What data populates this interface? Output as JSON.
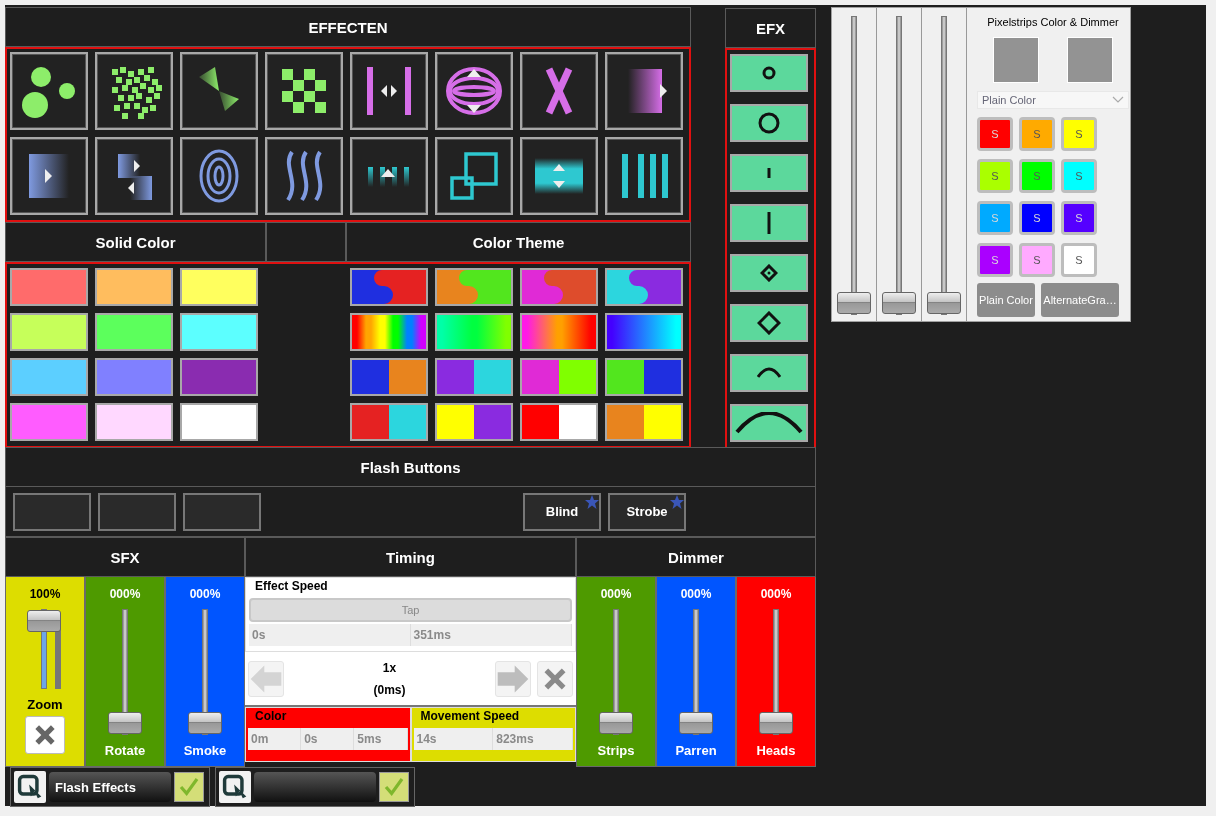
{
  "effecten": {
    "title": "EFFECTEN",
    "effects": [
      {
        "kind": "circles"
      },
      {
        "kind": "scatter"
      },
      {
        "kind": "wedge"
      },
      {
        "kind": "checker"
      },
      {
        "kind": "bars-arrows"
      },
      {
        "kind": "rings-arrows"
      },
      {
        "kind": "cross"
      },
      {
        "kind": "fade-right"
      },
      {
        "kind": "fade-arrow"
      },
      {
        "kind": "fade-pair"
      },
      {
        "kind": "rings"
      },
      {
        "kind": "waves"
      },
      {
        "kind": "bars-fade"
      },
      {
        "kind": "squares"
      },
      {
        "kind": "band"
      },
      {
        "kind": "bars"
      }
    ]
  },
  "solid_color": {
    "title": "Solid Color",
    "colors": [
      {
        "color": "#ff6b6b"
      },
      {
        "color": "#ffbd5e"
      },
      {
        "color": "#ffff5e"
      },
      {
        "color": "#c6ff5a"
      },
      {
        "color": "#5cff5c"
      },
      {
        "color": "#5cffff"
      },
      {
        "color": "#5ccfff"
      },
      {
        "color": "#8080ff"
      },
      {
        "color": "#8a2cb0"
      },
      {
        "color": "#ff5cff"
      },
      {
        "color": "#ffd8ff"
      },
      {
        "color": "#ffffff"
      }
    ]
  },
  "color_theme": {
    "title": "Color Theme",
    "themes": [
      {
        "kind": "swirl",
        "colors": [
          {
            "color": "#1f2fe0"
          },
          {
            "color": "#e52222"
          }
        ]
      },
      {
        "kind": "swirl",
        "colors": [
          {
            "color": "#e8841e"
          },
          {
            "color": "#52e61e"
          }
        ]
      },
      {
        "kind": "swirl",
        "colors": [
          {
            "color": "#e02ad6"
          },
          {
            "color": "#de4c2c"
          }
        ]
      },
      {
        "kind": "swirl",
        "colors": [
          {
            "color": "#2cd6de"
          },
          {
            "color": "#8a2be0"
          }
        ]
      },
      {
        "kind": "gradient",
        "colors": [
          {
            "color": "#ff0000"
          },
          {
            "color": "#ffa500"
          },
          {
            "color": "#ffff00"
          },
          {
            "color": "#00ff00"
          },
          {
            "color": "#0080ff"
          },
          {
            "color": "#d000ff"
          }
        ]
      },
      {
        "kind": "gradient",
        "colors": [
          {
            "color": "#00ffa8"
          },
          {
            "color": "#00ff40"
          },
          {
            "color": "#80ff00"
          }
        ]
      },
      {
        "kind": "gradient",
        "colors": [
          {
            "color": "#ff1ae6"
          },
          {
            "color": "#ffa000"
          },
          {
            "color": "#ff0000"
          }
        ]
      },
      {
        "kind": "gradient",
        "colors": [
          {
            "color": "#4400ff"
          },
          {
            "color": "#00ffff"
          }
        ]
      },
      {
        "kind": "split",
        "colors": [
          {
            "color": "#1f2fe0"
          },
          {
            "color": "#e8841e"
          }
        ]
      },
      {
        "kind": "split",
        "colors": [
          {
            "color": "#8a2be0"
          },
          {
            "color": "#2cd6de"
          }
        ]
      },
      {
        "kind": "split",
        "colors": [
          {
            "color": "#e02ad6"
          },
          {
            "color": "#80ff00"
          }
        ]
      },
      {
        "kind": "split",
        "colors": [
          {
            "color": "#52e61e"
          },
          {
            "color": "#1f2fe0"
          }
        ]
      },
      {
        "kind": "split",
        "colors": [
          {
            "color": "#e52222"
          },
          {
            "color": "#2cd6de"
          }
        ]
      },
      {
        "kind": "split",
        "colors": [
          {
            "color": "#ffff00"
          },
          {
            "color": "#8a2be0"
          }
        ]
      },
      {
        "kind": "split",
        "colors": [
          {
            "color": "#ff0000"
          },
          {
            "color": "#ffffff"
          }
        ]
      },
      {
        "kind": "split",
        "colors": [
          {
            "color": "#e8841e"
          },
          {
            "color": "#ffff00"
          }
        ]
      }
    ]
  },
  "efx": {
    "title": "EFX",
    "buttons": [
      {
        "kind": "small-circle"
      },
      {
        "kind": "circle"
      },
      {
        "kind": "short-line"
      },
      {
        "kind": "line"
      },
      {
        "kind": "small-diamond"
      },
      {
        "kind": "diamond"
      },
      {
        "kind": "small-arc"
      },
      {
        "kind": "arc"
      }
    ]
  },
  "flash": {
    "title": "Flash Buttons",
    "buttons": [
      {
        "kind": "blank"
      },
      {
        "kind": "blank"
      },
      {
        "kind": "blank"
      },
      {
        "kind": "labeled",
        "label": "Blind",
        "starred": true
      },
      {
        "kind": "labeled",
        "label": "Strobe",
        "starred": true
      }
    ]
  },
  "sfx": {
    "title": "SFX",
    "channels": [
      {
        "kind": "zoom",
        "reading": "100%",
        "label": "Zoom",
        "level": 1,
        "color": "#dddd00"
      },
      {
        "kind": "plain",
        "reading": "000%",
        "label": "Rotate",
        "level": 0,
        "color": "#4e9a00"
      },
      {
        "kind": "plain",
        "reading": "000%",
        "label": "Smoke",
        "level": 0,
        "color": "#0055ff"
      }
    ]
  },
  "timing": {
    "title": "Timing",
    "effect_speed": {
      "title": "Effect Speed",
      "tap": "Tap",
      "fields": [
        "0s",
        "351ms"
      ]
    },
    "multiplier": "1x",
    "multiplier_time": "(0ms)",
    "color_speed": {
      "title": "Color",
      "fields": [
        "0m",
        "0s",
        "5ms"
      ]
    },
    "movement_speed": {
      "title": "Movement Speed",
      "fields": [
        "14s",
        "823ms"
      ]
    }
  },
  "dimmer": {
    "title": "Dimmer",
    "channels": [
      {
        "kind": "plain",
        "reading": "000%",
        "label": "Strips",
        "level": 0,
        "color": "#4e9a00"
      },
      {
        "kind": "plain",
        "reading": "000%",
        "label": "Parren",
        "level": 0,
        "color": "#0055ff"
      },
      {
        "kind": "plain",
        "reading": "000%",
        "label": "Heads",
        "level": 0,
        "color": "#ff0000"
      }
    ]
  },
  "pixelstrips": {
    "title": "Pixelstrips Color & Dimmer",
    "sliders": [
      {
        "level": 0
      },
      {
        "level": 0
      },
      {
        "level": 0
      }
    ],
    "preset": "Plain Color",
    "color_buttons": [
      {
        "label": "S",
        "color": "#ff0000"
      },
      {
        "label": "S",
        "color": "#ffaa00"
      },
      {
        "label": "S",
        "color": "#ffff00"
      },
      {
        "label": "S",
        "color": "#aaff00"
      },
      {
        "label": "S",
        "color": "#00ff00"
      },
      {
        "label": "S",
        "color": "#00ffff"
      },
      {
        "label": "S",
        "color": "#00aaff"
      },
      {
        "label": "S",
        "color": "#0000ff"
      },
      {
        "label": "S",
        "color": "#5500ff"
      },
      {
        "label": "S",
        "color": "#aa00ff"
      },
      {
        "label": "S",
        "color": "#ffaaff"
      },
      {
        "label": "S",
        "color": "#ffffff"
      }
    ],
    "mode_buttons": [
      {
        "label": "Plain Color",
        "disabled": true
      },
      {
        "label": "AlternateGra…",
        "disabled": true
      }
    ]
  },
  "cues": [
    {
      "name": "Flash Effects",
      "checked": true
    },
    {
      "checked": true
    }
  ]
}
